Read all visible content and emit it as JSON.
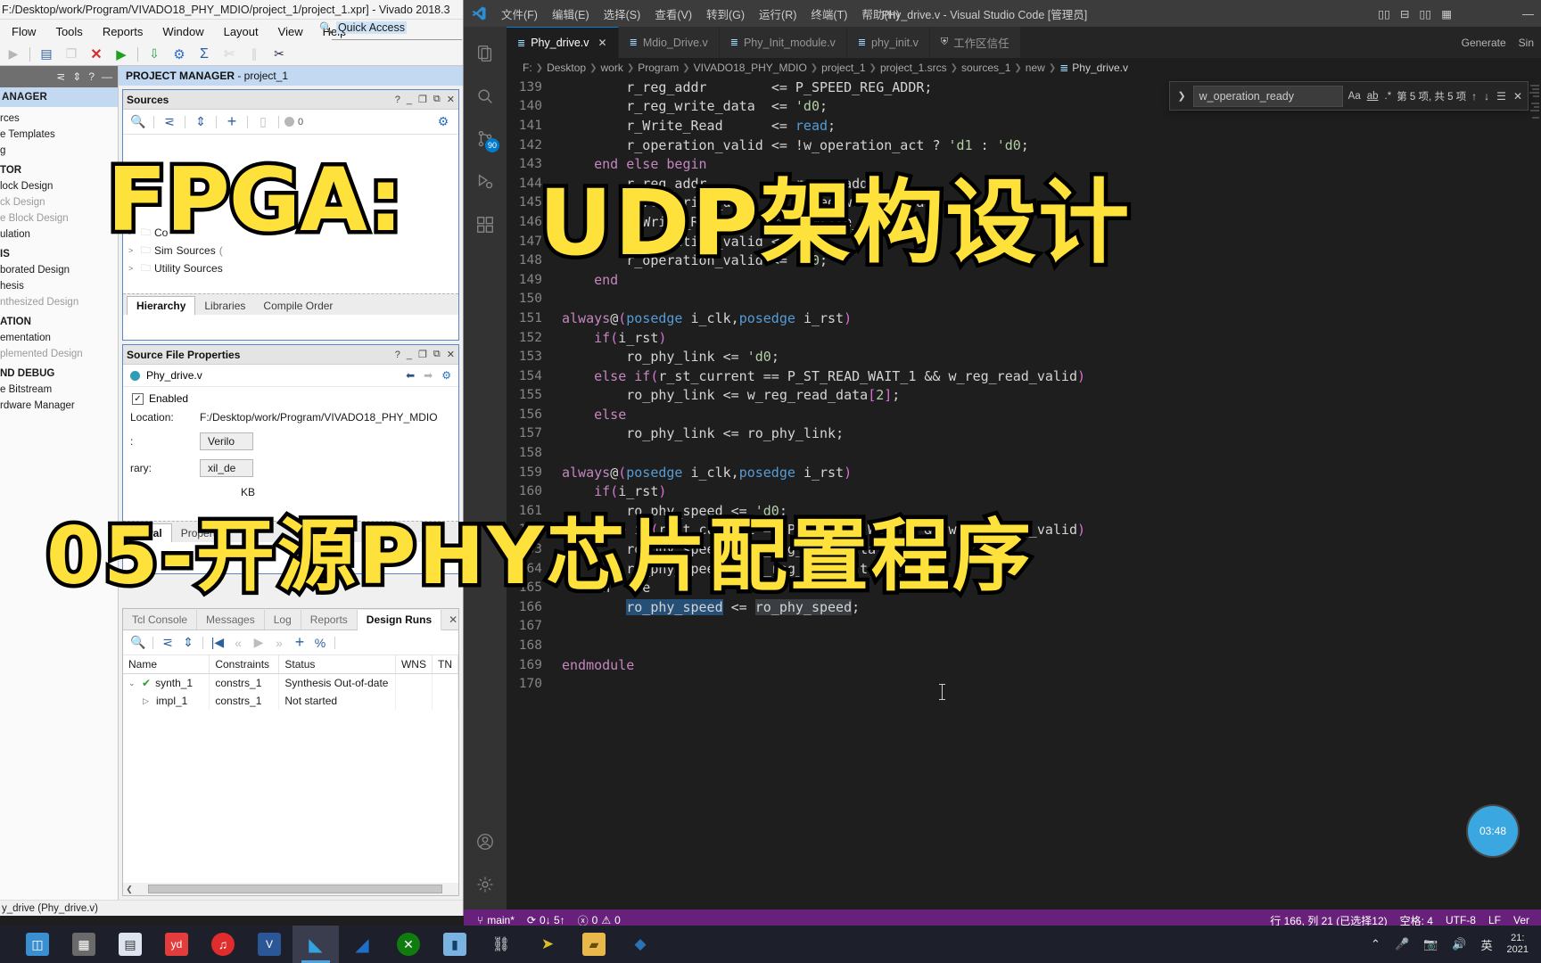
{
  "vivado": {
    "titlebar": "F:/Desktop/work/Program/VIVADO18_PHY_MDIO/project_1/project_1.xpr] - Vivado 2018.3",
    "menus": [
      "Flow",
      "Tools",
      "Reports",
      "Window",
      "Layout",
      "View",
      "Help"
    ],
    "quick_access": "Quick Access",
    "project_manager_banner_bold": "PROJECT MANAGER",
    "project_manager_banner_rest": " - project_1",
    "flow_navigator": {
      "title": "ANAGER",
      "items": [
        {
          "label": "rces",
          "group": false,
          "dim": false
        },
        {
          "label": "e Templates",
          "group": false,
          "dim": false
        },
        {
          "label": "g",
          "group": false,
          "dim": false
        },
        {
          "label": "TOR",
          "group": true,
          "dim": false
        },
        {
          "label": "lock Design",
          "group": false,
          "dim": false
        },
        {
          "label": "ck Design",
          "group": false,
          "dim": true
        },
        {
          "label": "e Block Design",
          "group": false,
          "dim": true
        },
        {
          "label": "ulation",
          "group": false,
          "dim": false
        },
        {
          "label": "IS",
          "group": true,
          "dim": false
        },
        {
          "label": "borated Design",
          "group": false,
          "dim": false
        },
        {
          "label": "hesis",
          "group": false,
          "dim": false
        },
        {
          "label": "nthesized Design",
          "group": false,
          "dim": true
        },
        {
          "label": "ATION",
          "group": true,
          "dim": false
        },
        {
          "label": "ementation",
          "group": false,
          "dim": false
        },
        {
          "label": "plemented Design",
          "group": false,
          "dim": true
        },
        {
          "label": "ND DEBUG",
          "group": true,
          "dim": false
        },
        {
          "label": "e Bitstream",
          "group": false,
          "dim": false
        },
        {
          "label": "rdware Manager",
          "group": false,
          "dim": false
        }
      ]
    },
    "sources_panel": {
      "title": "Sources",
      "badge_count": "0",
      "tree": [
        {
          "label": "Co",
          "dim": false
        },
        {
          "label": "Sim",
          "suffix": "Sources",
          "paren": "(",
          "dim": false
        },
        {
          "label": "Utility Sources",
          "dim": false
        }
      ],
      "tabs": [
        "Hierarchy",
        "Libraries",
        "Compile Order"
      ],
      "active_tab": "Hierarchy"
    },
    "source_file_properties": {
      "title": "Source File Properties",
      "file_name": "Phy_drive.v",
      "enabled_label": "Enabled",
      "location_label": "Location:",
      "location_value": "F:/Desktop/work/Program/VIVADO18_PHY_MDIO",
      "type_label": ":",
      "type_value": "Verilo",
      "library_label": "rary:",
      "library_value": "xil_de",
      "size_value": "KB",
      "tabs": [
        "neral",
        "Properties"
      ],
      "active_tab": "neral"
    },
    "bottom_panel": {
      "tabs": [
        "Tcl Console",
        "Messages",
        "Log",
        "Reports",
        "Design Runs"
      ],
      "active_tab": "Design Runs",
      "columns": [
        "Name",
        "Constraints",
        "Status",
        "WNS",
        "TN"
      ],
      "rows": [
        {
          "name": "synth_1",
          "constraints": "constrs_1",
          "status": "Synthesis Out-of-date",
          "wns": "",
          "tns": ""
        },
        {
          "name": "impl_1",
          "constraints": "constrs_1",
          "status": "Not started",
          "wns": "",
          "tns": ""
        }
      ]
    },
    "status_text": "y_drive (Phy_drive.v)"
  },
  "vscode": {
    "menus": [
      "文件(F)",
      "编辑(E)",
      "选择(S)",
      "查看(V)",
      "转到(G)",
      "运行(R)",
      "终端(T)",
      "帮助(H)"
    ],
    "window_title": "Phy_drive.v - Visual Studio Code [管理员]",
    "tabs": [
      {
        "label": "Phy_drive.v",
        "active": true,
        "close": "✕"
      },
      {
        "label": "Mdio_Drive.v",
        "active": false
      },
      {
        "label": "Phy_Init_module.v",
        "active": false
      },
      {
        "label": "phy_init.v",
        "active": false
      },
      {
        "label": "工作区信任",
        "active": false,
        "shield": true
      }
    ],
    "tabs_right": [
      "Generate",
      "Sin"
    ],
    "breadcrumbs": [
      "F:",
      "Desktop",
      "work",
      "Program",
      "VIVADO18_PHY_MDIO",
      "project_1",
      "project_1.srcs",
      "sources_1",
      "new",
      "Phy_drive.v"
    ],
    "find_widget": {
      "query": "w_operation_ready",
      "opt_case": "Aa",
      "opt_word": "ab",
      "opt_regex": ".*",
      "match_count": "第 5 项, 共 5 项",
      "prev": "↑",
      "next": "↓",
      "selection": "☰",
      "close": "✕"
    },
    "activity_badge": "90",
    "code_lines": [
      {
        "n": 139,
        "text": "        r_reg_addr        <= P_SPEED_REG_ADDR;"
      },
      {
        "n": 140,
        "text": "        r_reg_write_data  <= 'd0;"
      },
      {
        "n": 141,
        "text": "        r_Write_Read      <= read;"
      },
      {
        "n": 142,
        "text": "        r_operation_valid <= !w_operation_act ? 'd1 : 'd0;"
      },
      {
        "n": 143,
        "text": "    end else begin"
      },
      {
        "n": 144,
        "text": "        r_reg_addr        <= r_reg_addr;"
      },
      {
        "n": 145,
        "text": "        r_reg_write_data  <= r_reg_write_data;"
      },
      {
        "n": 146,
        "text": "        r_Write_Read      <= r_Write_Read;"
      },
      {
        "n": 147,
        "text": "        r_operation_valid <= 'd0;"
      },
      {
        "n": 148,
        "text": "        r_operation_valid <= 'd0;"
      },
      {
        "n": 149,
        "text": "    end"
      },
      {
        "n": 150,
        "text": ""
      },
      {
        "n": 151,
        "text": "always@(posedge i_clk,posedge i_rst)"
      },
      {
        "n": 152,
        "text": "    if(i_rst)"
      },
      {
        "n": 153,
        "text": "        ro_phy_link <= 'd0;"
      },
      {
        "n": 154,
        "text": "    else if(r_st_current == P_ST_READ_WAIT_1 && w_reg_read_valid)"
      },
      {
        "n": 155,
        "text": "        ro_phy_link <= w_reg_read_data[2];"
      },
      {
        "n": 156,
        "text": "    else"
      },
      {
        "n": 157,
        "text": "        ro_phy_link <= ro_phy_link;"
      },
      {
        "n": 158,
        "text": ""
      },
      {
        "n": 159,
        "text": "always@(posedge i_clk,posedge i_rst)"
      },
      {
        "n": 160,
        "text": "    if(i_rst)"
      },
      {
        "n": 161,
        "text": "        ro_phy_speed <= 'd0;"
      },
      {
        "n": 162,
        "text": "    else if(r_st_current == P_ST_READ_WAIT_2 && w_reg_read_valid)"
      },
      {
        "n": 163,
        "text": "        ro_phy_speed <= w_reg_read_data[6:5];"
      },
      {
        "n": 164,
        "text": "        ro_phy_speed <= w_reg_read_data[6:5];"
      },
      {
        "n": 165,
        "text": "    en   se"
      },
      {
        "n": 166,
        "text": "        ro_phy_speed <= ro_phy_speed;"
      },
      {
        "n": 167,
        "text": ""
      },
      {
        "n": 168,
        "text": ""
      },
      {
        "n": 169,
        "text": "endmodule"
      },
      {
        "n": 170,
        "text": ""
      }
    ],
    "status_bar": {
      "branch": "main*",
      "sync": "0↓ 5↑",
      "errors": "0",
      "warnings": "0",
      "cursor": "行 166, 列 21 (已选择12)",
      "spaces": "空格: 4",
      "encoding": "UTF-8",
      "eol": "LF",
      "language": "Ver"
    }
  },
  "overlay": {
    "line1": "FPGA:",
    "line2": "UDP架构设计",
    "line3": "05-开源PHY芯片配置程序",
    "circle_text": "03:48"
  },
  "taskbar": {
    "icons": [
      "contacts-icon",
      "calculator-icon",
      "sticky-notes-icon",
      "youdao-icon",
      "netease-music-icon",
      "visio-icon",
      "vscode-icon",
      "wireshark-icon",
      "xbox-icon",
      "media-icon",
      "network-icon",
      "vivado-icon",
      "folder-icon",
      "modelsim-icon"
    ],
    "tray": {
      "ime": "英",
      "time": "21:",
      "date": "2021"
    }
  },
  "colors": {
    "vscode_status_bg": "#68217a",
    "accent_blue": "#007acc",
    "overlay_yellow": "#FFE13B",
    "vivado_banner": "#c3d9f2"
  }
}
